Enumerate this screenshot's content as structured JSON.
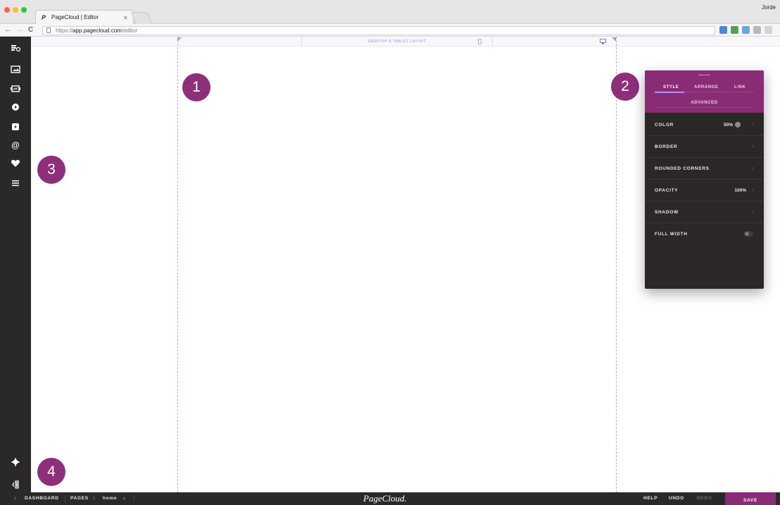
{
  "browser": {
    "tab_title": "PageCloud | Editor",
    "tab_favicon": "P",
    "tab_close": "×",
    "user": "Jorde",
    "url_scheme": "https://",
    "url_host": "app.pagecloud.com",
    "url_path": "/editor",
    "nav_back": "←",
    "nav_forward": "→",
    "nav_reload": "C"
  },
  "canvas": {
    "layout_label": "DESKTOP & TABLET LAYOUT"
  },
  "badges": [
    "1",
    "2",
    "3",
    "4"
  ],
  "panel": {
    "tabs": [
      "STYLE",
      "ARRANGE",
      "LINK"
    ],
    "active_tab": "STYLE",
    "advanced_tab": "ADVANCED",
    "properties": [
      {
        "label": "COLOR",
        "value": "50%",
        "control": "color-swatch",
        "swatch_color": "#8d8d8d"
      },
      {
        "label": "BORDER",
        "value": ""
      },
      {
        "label": "ROUNDED CORNERS",
        "value": ""
      },
      {
        "label": "OPACITY",
        "value": "100%"
      },
      {
        "label": "SHADOW",
        "value": ""
      },
      {
        "label": "FULL WIDTH",
        "value": "",
        "control": "toggle",
        "toggle_on": false
      }
    ]
  },
  "sidebar": {
    "tools": [
      "text-tool-icon",
      "image-tool-icon",
      "gallery-tool-icon",
      "video-tool-icon",
      "media-tool-icon",
      "contact-tool-icon",
      "favorite-tool-icon",
      "menu-tool-icon"
    ],
    "bottom": [
      "settings-icon",
      "collapse-sidebar-icon"
    ]
  },
  "bottombar": {
    "dashboard": "DASHBOARD",
    "pages": "PAGES",
    "page_name": "home",
    "brand": "PageCloud.",
    "help": "HELP",
    "undo": "UNDO",
    "redo": "REDO",
    "save": "SAVE"
  },
  "colors": {
    "brand_purple": "#8a2b76",
    "sidebar_dark": "#2b2828",
    "guide_pink": "#d59be0",
    "label_violet": "#9a85d9"
  }
}
